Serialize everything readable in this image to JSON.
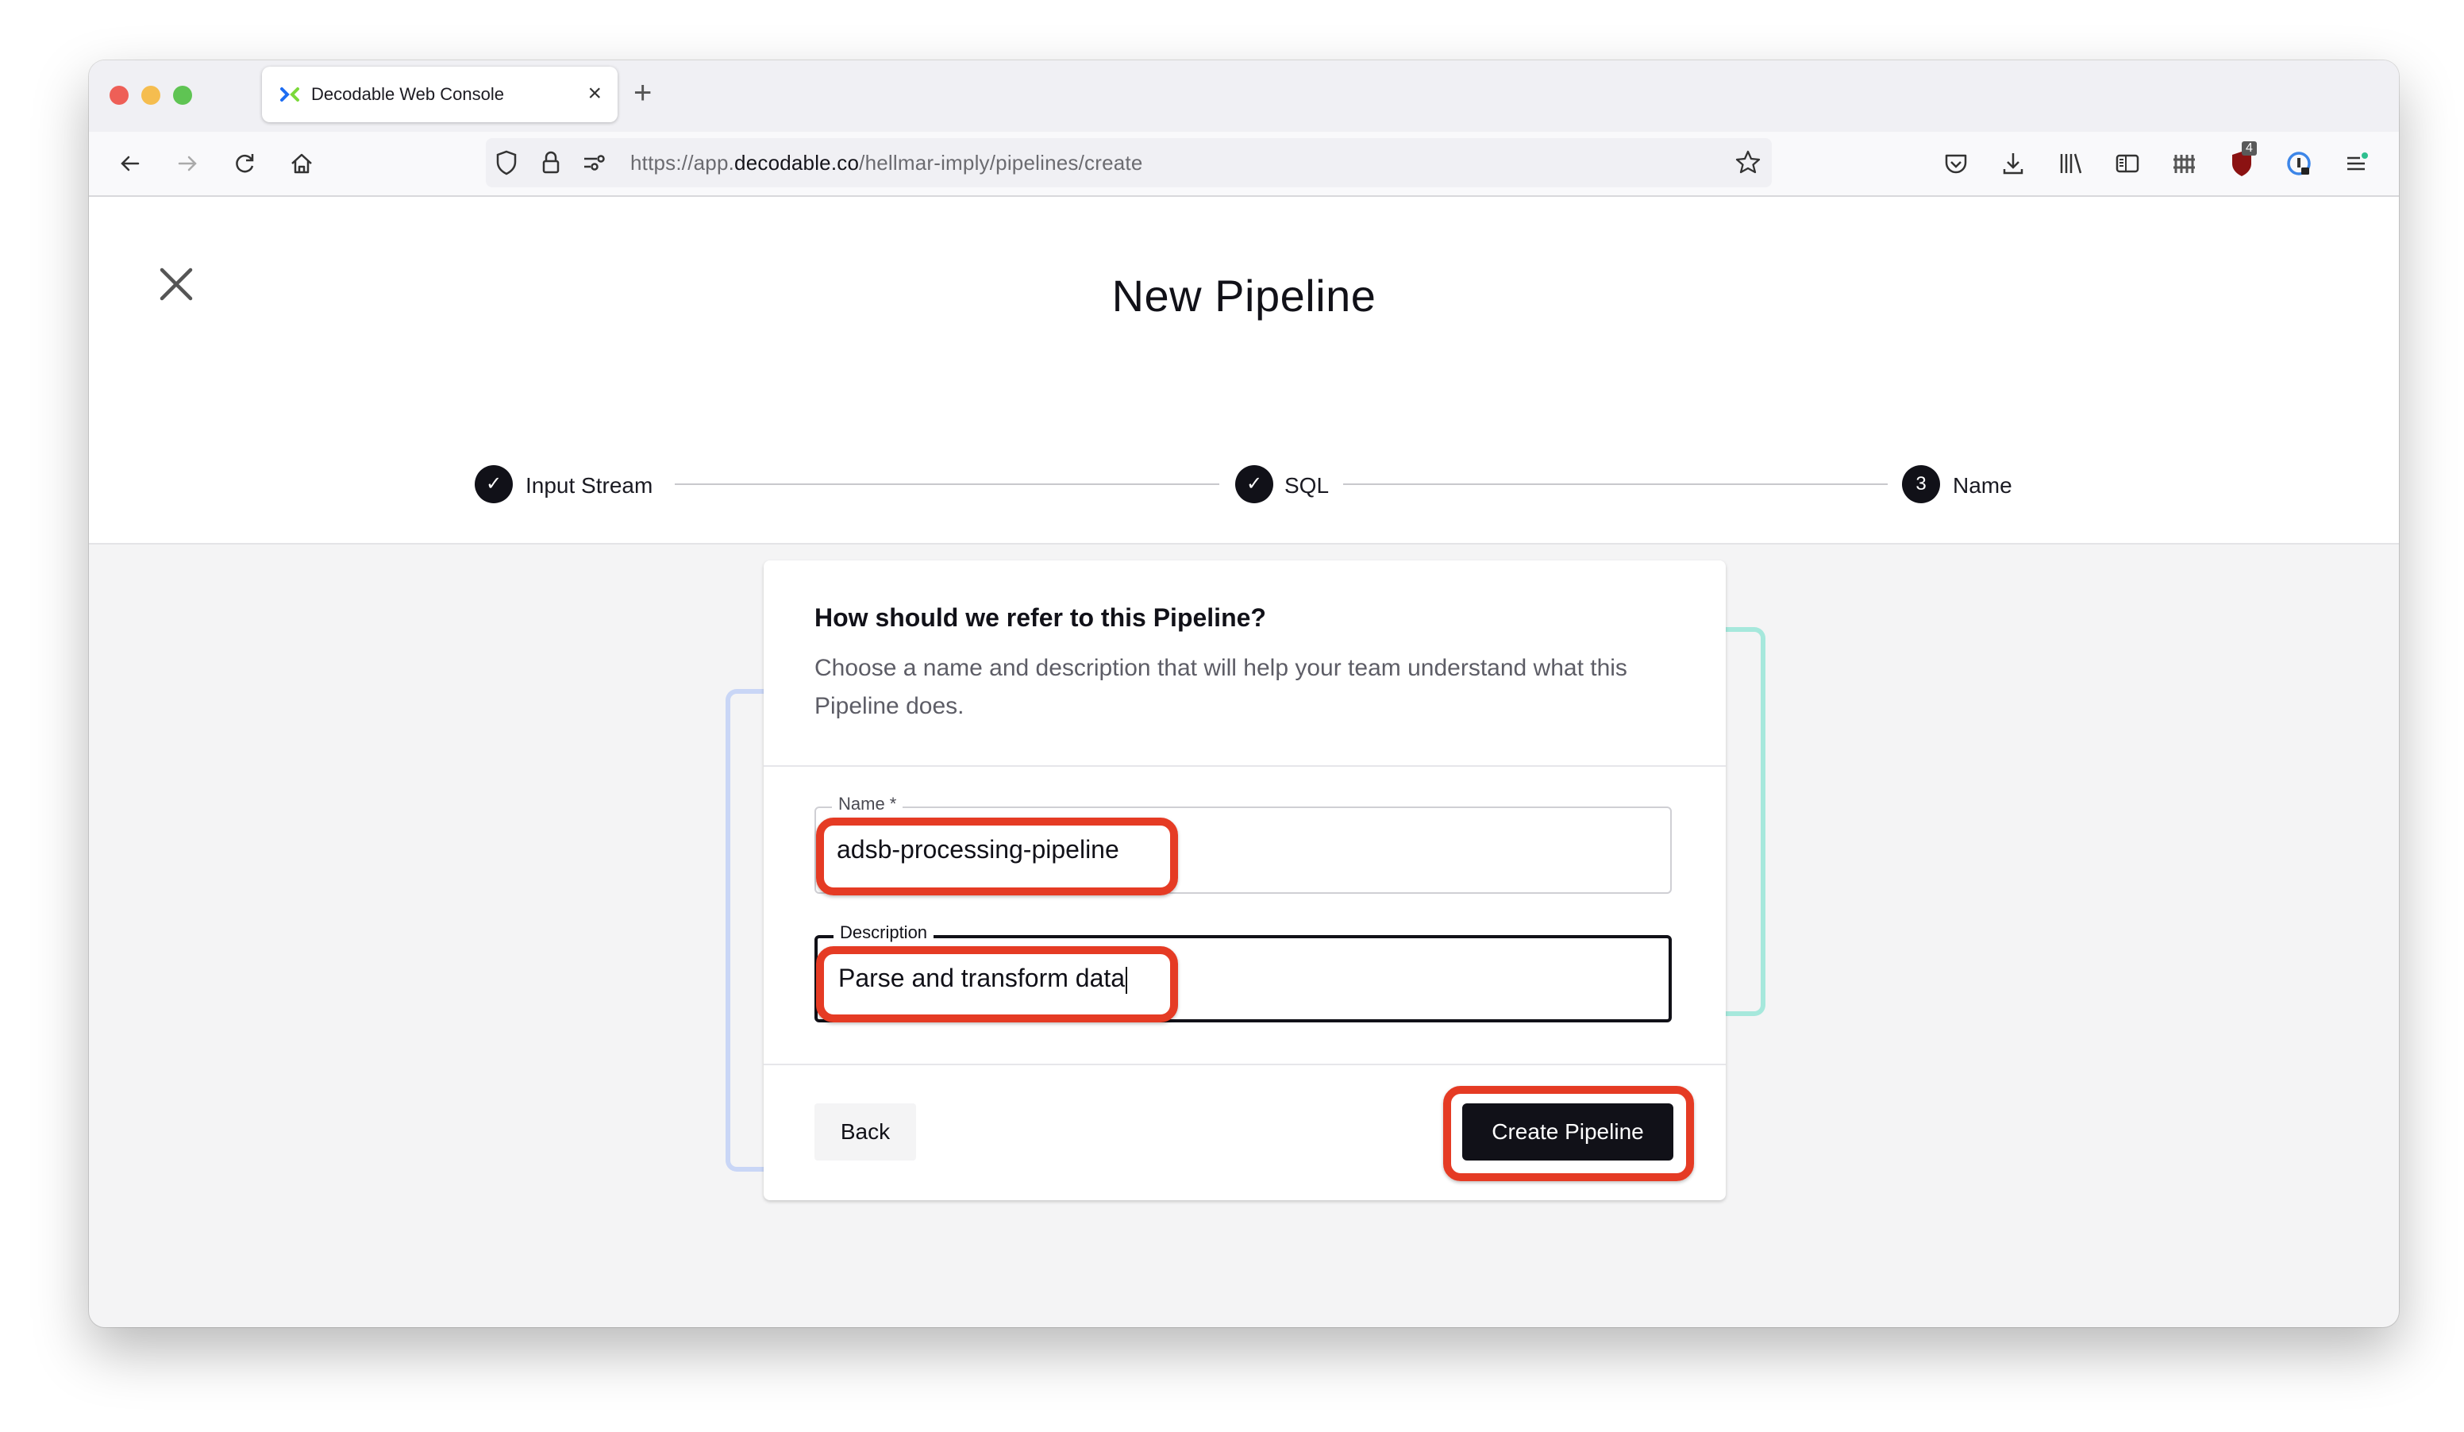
{
  "browser": {
    "tab_title": "Decodable Web Console",
    "tab_close_label": "×",
    "new_tab_label": "+",
    "url_scheme": "https://app.",
    "url_host": "decodable.co",
    "url_path": "/hellmar-imply/pipelines/create",
    "extension_badge": "4",
    "toolbar_icons": [
      "back-icon",
      "forward-icon",
      "reload-icon",
      "home-icon",
      "shield-icon",
      "lock-icon",
      "permissions-icon",
      "bookmark-star-icon",
      "pocket-icon",
      "download-icon",
      "library-icon",
      "sidebar-icon",
      "fence-extension-icon",
      "ublock-icon",
      "password-manager-icon",
      "menu-icon"
    ]
  },
  "page": {
    "title": "New Pipeline",
    "close_icon": "close-icon",
    "steps": [
      {
        "label": "Input Stream",
        "status": "complete",
        "marker": "✓"
      },
      {
        "label": "SQL",
        "status": "complete",
        "marker": "✓"
      },
      {
        "label": "Name",
        "status": "current",
        "marker": "3"
      }
    ]
  },
  "form": {
    "question": "How should we refer to this Pipeline?",
    "subtitle": "Choose a name and description that will help your team understand what this Pipeline does.",
    "name_label": "Name *",
    "name_value": "adsb-processing-pipeline",
    "description_label": "Description",
    "description_value": "Parse and transform data",
    "back_label": "Back",
    "create_label": "Create Pipeline"
  },
  "colors": {
    "highlight": "#e53b24",
    "primary_button": "#111118",
    "deco_left": "#c9d6f6",
    "deco_right": "#a6e8dc"
  }
}
